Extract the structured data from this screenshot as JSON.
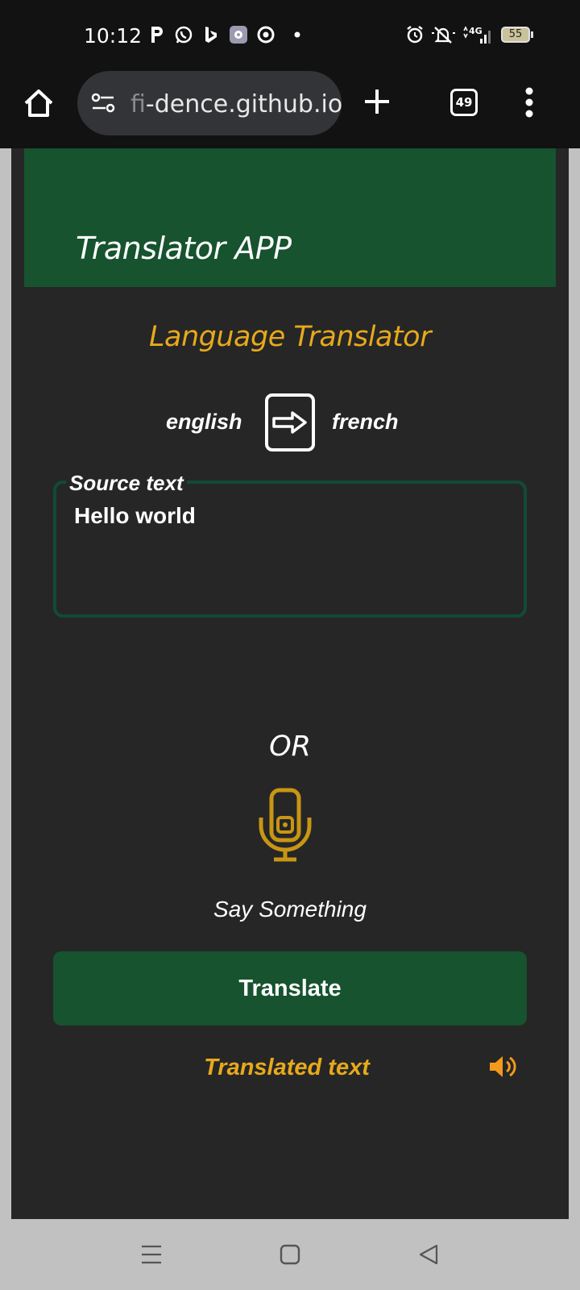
{
  "status_bar": {
    "time": "10:12",
    "network": "4G",
    "battery": "55"
  },
  "browser": {
    "url_faded": "fi",
    "url_main": "-dence.github.io",
    "tab_count": "49"
  },
  "app": {
    "title": "Translator APP",
    "heading": "Language Translator",
    "source_language": "english",
    "target_language": "french",
    "source_label": "Source text",
    "source_value": "Hello world",
    "or_label": "OR",
    "voice_label": "Say Something",
    "translate_button": "Translate",
    "translated_placeholder": "Translated text"
  },
  "colors": {
    "header_green": "#16532e",
    "accent_gold": "#e7a91c",
    "page_bg": "#262626"
  }
}
